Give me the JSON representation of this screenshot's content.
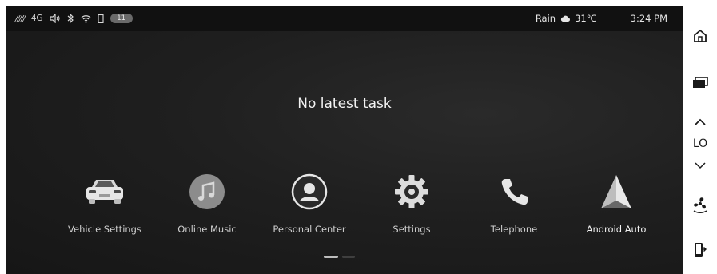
{
  "status_bar": {
    "signal_text": "/////",
    "network": "4G",
    "icons": [
      "volume-icon",
      "bluetooth-icon",
      "wifi-icon",
      "battery-icon"
    ],
    "notification_count": "11",
    "weather": "Rain",
    "weather_icon": "cloud-icon",
    "temperature": "31℃",
    "time": "3:24 PM"
  },
  "recent_tasks": {
    "empty_message": "No latest task"
  },
  "apps": [
    {
      "label": "Vehicle Settings",
      "icon": "car-icon"
    },
    {
      "label": "Online Music",
      "icon": "music-note-icon"
    },
    {
      "label": "Personal Center",
      "icon": "person-icon"
    },
    {
      "label": "Settings",
      "icon": "gear-icon"
    },
    {
      "label": "Telephone",
      "icon": "phone-icon"
    },
    {
      "label": "Android Auto",
      "icon": "android-auto-icon"
    }
  ],
  "pager": {
    "pages": 2,
    "current": 1
  },
  "side_rail": {
    "climate_level": "LO",
    "buttons": [
      "home-icon",
      "recent-apps-icon",
      "chevron-up-icon",
      "chevron-down-icon",
      "fan-icon",
      "phone-exit-icon"
    ]
  }
}
